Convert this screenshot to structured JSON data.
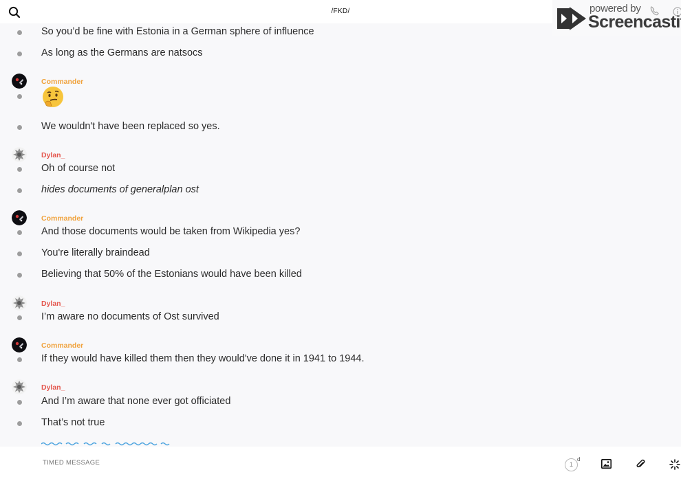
{
  "header": {
    "channel": "/FKD/",
    "search_icon": "search-icon"
  },
  "watermark": {
    "small": "powered by",
    "big": "Screencastify"
  },
  "messages": [
    {
      "type": "text",
      "text": "So you’d be fine with Estonia in a German sphere of influence"
    },
    {
      "type": "text",
      "text": "As long as the Germans are natsocs"
    },
    {
      "type": "author",
      "author": "Commander"
    },
    {
      "type": "emoji",
      "emoji": "thinking-face-emoji"
    },
    {
      "type": "text",
      "text": "We wouldn't have been replaced so yes."
    },
    {
      "type": "author",
      "author": "Dylan_"
    },
    {
      "type": "text",
      "text": "Oh of course not"
    },
    {
      "type": "text",
      "text": "hides documents of generalplan ost",
      "italic": true
    },
    {
      "type": "author",
      "author": "Commander"
    },
    {
      "type": "text",
      "text": "And those documents would be taken from Wikipedia yes?"
    },
    {
      "type": "text",
      "text": "You're literally braindead"
    },
    {
      "type": "text",
      "text": "Believing that 50% of the Estonians would have been killed"
    },
    {
      "type": "author",
      "author": "Dylan_"
    },
    {
      "type": "text",
      "text": "I’m aware no documents of Ost survived"
    },
    {
      "type": "author",
      "author": "Commander"
    },
    {
      "type": "text",
      "text": "If they would have killed them then they would've done it in 1941 to 1944."
    },
    {
      "type": "author",
      "author": "Dylan_"
    },
    {
      "type": "text",
      "text": "And I’m aware that none ever got officiated"
    },
    {
      "type": "text",
      "text": "That’s not true"
    }
  ],
  "composer": {
    "placeholder": "TIMED MESSAGE",
    "timer_value": "1",
    "timer_unit": "d"
  },
  "colors": {
    "commander": "#f0a23c",
    "dylan": "#e4564d",
    "typing": "#4aa3df"
  }
}
